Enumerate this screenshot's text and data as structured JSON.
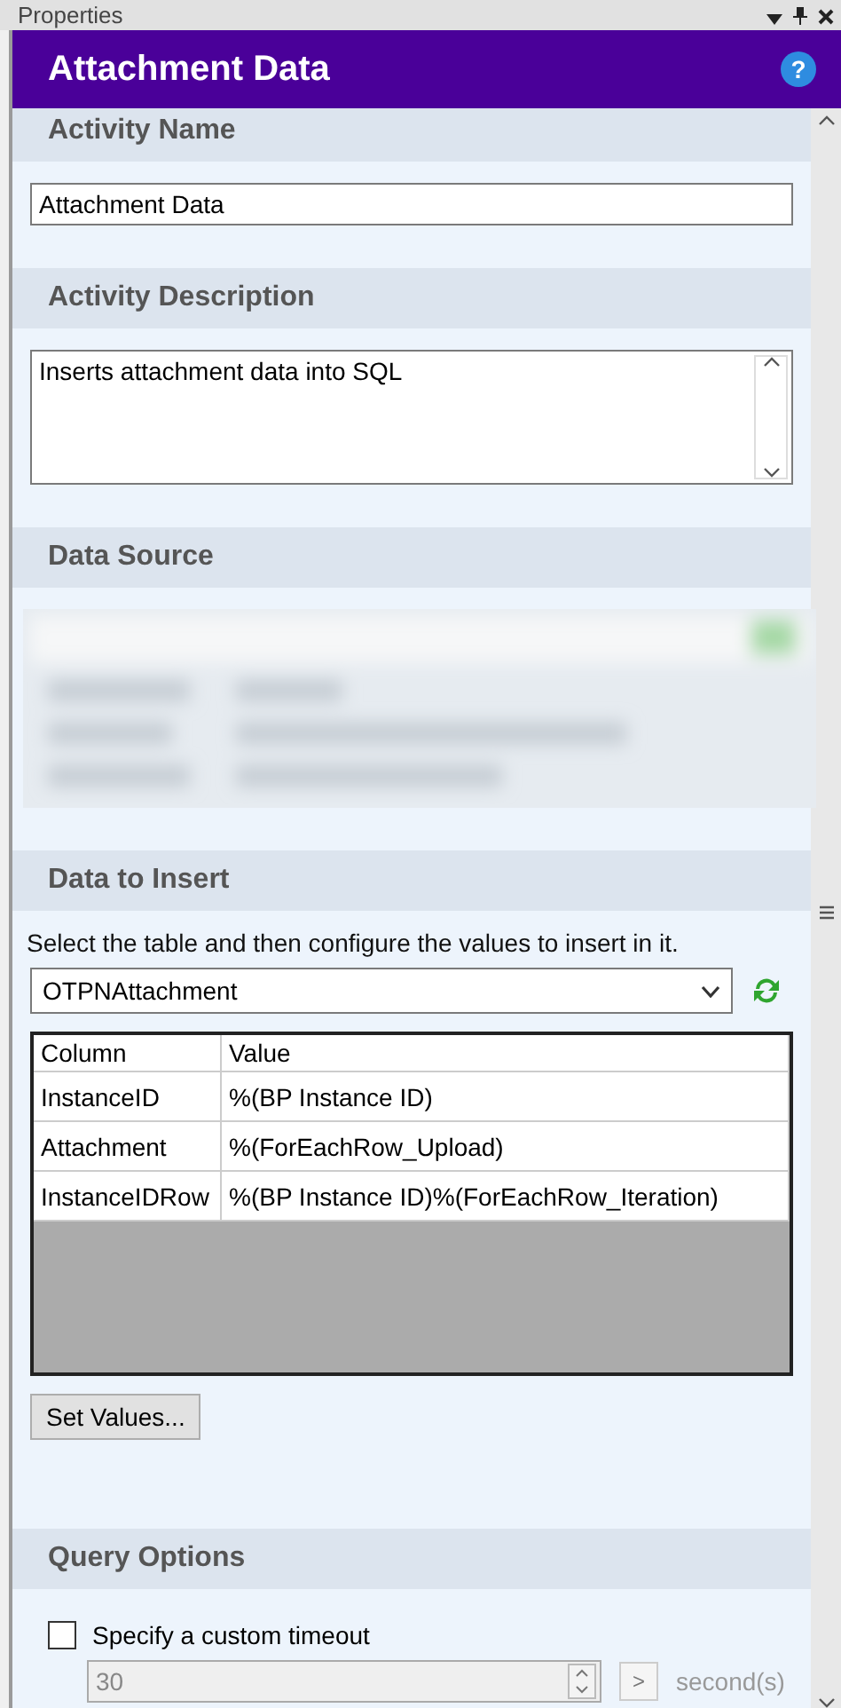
{
  "panel": {
    "title": "Properties"
  },
  "banner": {
    "title": "Attachment Data",
    "help": "?"
  },
  "activity_name": {
    "heading": "Activity Name",
    "value": "Attachment Data"
  },
  "activity_description": {
    "heading": "Activity Description",
    "value": "Inserts attachment data into SQL"
  },
  "data_source": {
    "heading": "Data Source"
  },
  "data_to_insert": {
    "heading": "Data to Insert",
    "instruction": "Select the table and then configure the values to insert in it.",
    "table_select": "OTPNAttachment",
    "table": {
      "columns": [
        "Column",
        "Value"
      ],
      "rows": [
        [
          "InstanceID",
          "%(BP Instance ID)"
        ],
        [
          "Attachment",
          "%(ForEachRow_Upload)"
        ],
        [
          "InstanceIDRow",
          "%(BP Instance ID)%(ForEachRow_Iteration)"
        ]
      ]
    },
    "set_values_button": "Set Values..."
  },
  "query_options": {
    "heading": "Query Options",
    "custom_timeout": {
      "label": "Specify a custom timeout",
      "checked": false
    },
    "timeout_value": "30",
    "arrow_button": ">",
    "unit": "second(s)"
  }
}
